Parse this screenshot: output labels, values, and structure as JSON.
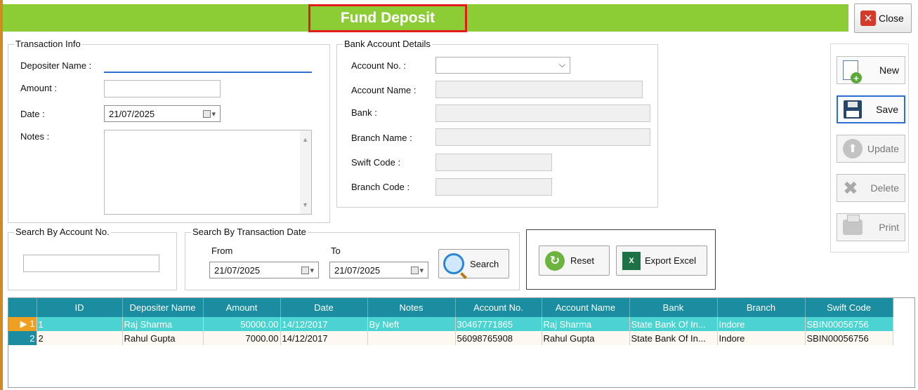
{
  "window": {
    "title": "Fund Deposit",
    "close_label": "Close"
  },
  "transaction_info": {
    "legend": "Transaction Info",
    "depositer_name_label": "Depositer Name :",
    "depositer_name_value": "",
    "amount_label": "Amount :",
    "amount_value": "",
    "date_label": "Date :",
    "date_value": "21/07/2025",
    "notes_label": "Notes :",
    "notes_value": ""
  },
  "bank_account": {
    "legend": "Bank Account Details",
    "account_no_label": "Account No. :",
    "account_no_value": "",
    "account_name_label": "Account Name :",
    "bank_label": "Bank :",
    "branch_name_label": "Branch Name :",
    "swift_code_label": "Swift Code :",
    "branch_code_label": "Branch Code :"
  },
  "sidebar": {
    "new_label": "New",
    "save_label": "Save",
    "update_label": "Update",
    "delete_label": "Delete",
    "print_label": "Print"
  },
  "search_account": {
    "legend": "Search By Account No.",
    "value": ""
  },
  "search_date": {
    "legend": "Search By Transaction Date",
    "from_label": "From",
    "to_label": "To",
    "from_value": "21/07/2025",
    "to_value": "21/07/2025",
    "search_label": "Search"
  },
  "actions": {
    "reset_label": "Reset",
    "export_label": "Export Excel"
  },
  "grid": {
    "columns": [
      "ID",
      "Depositer Name",
      "Amount",
      "Date",
      "Notes",
      "Account No.",
      "Account Name",
      "Bank",
      "Branch",
      "Swift Code"
    ],
    "rows": [
      {
        "num": "1",
        "id": "1",
        "name": "Raj Sharma",
        "amount": "50000.00",
        "date": "14/12/2017",
        "notes": "By Neft",
        "account_no": "30467771865",
        "account_name": "Raj Sharma",
        "bank": "State Bank Of In...",
        "branch": "Indore",
        "swift": "SBIN00056756"
      },
      {
        "num": "2",
        "id": "2",
        "name": "Rahul Gupta",
        "amount": "7000.00",
        "date": "14/12/2017",
        "notes": "",
        "account_no": "56098765908",
        "account_name": "Rahul Gupta",
        "bank": "State Bank Of In...",
        "branch": "Indore",
        "swift": "SBIN00056756"
      }
    ]
  },
  "colors": {
    "title_bar": "#8ccd35",
    "title_border": "#e21c1c",
    "grid_header": "#1b8da0",
    "selected_row": "#4ad3d0",
    "current_row_marker": "#f0a020"
  }
}
